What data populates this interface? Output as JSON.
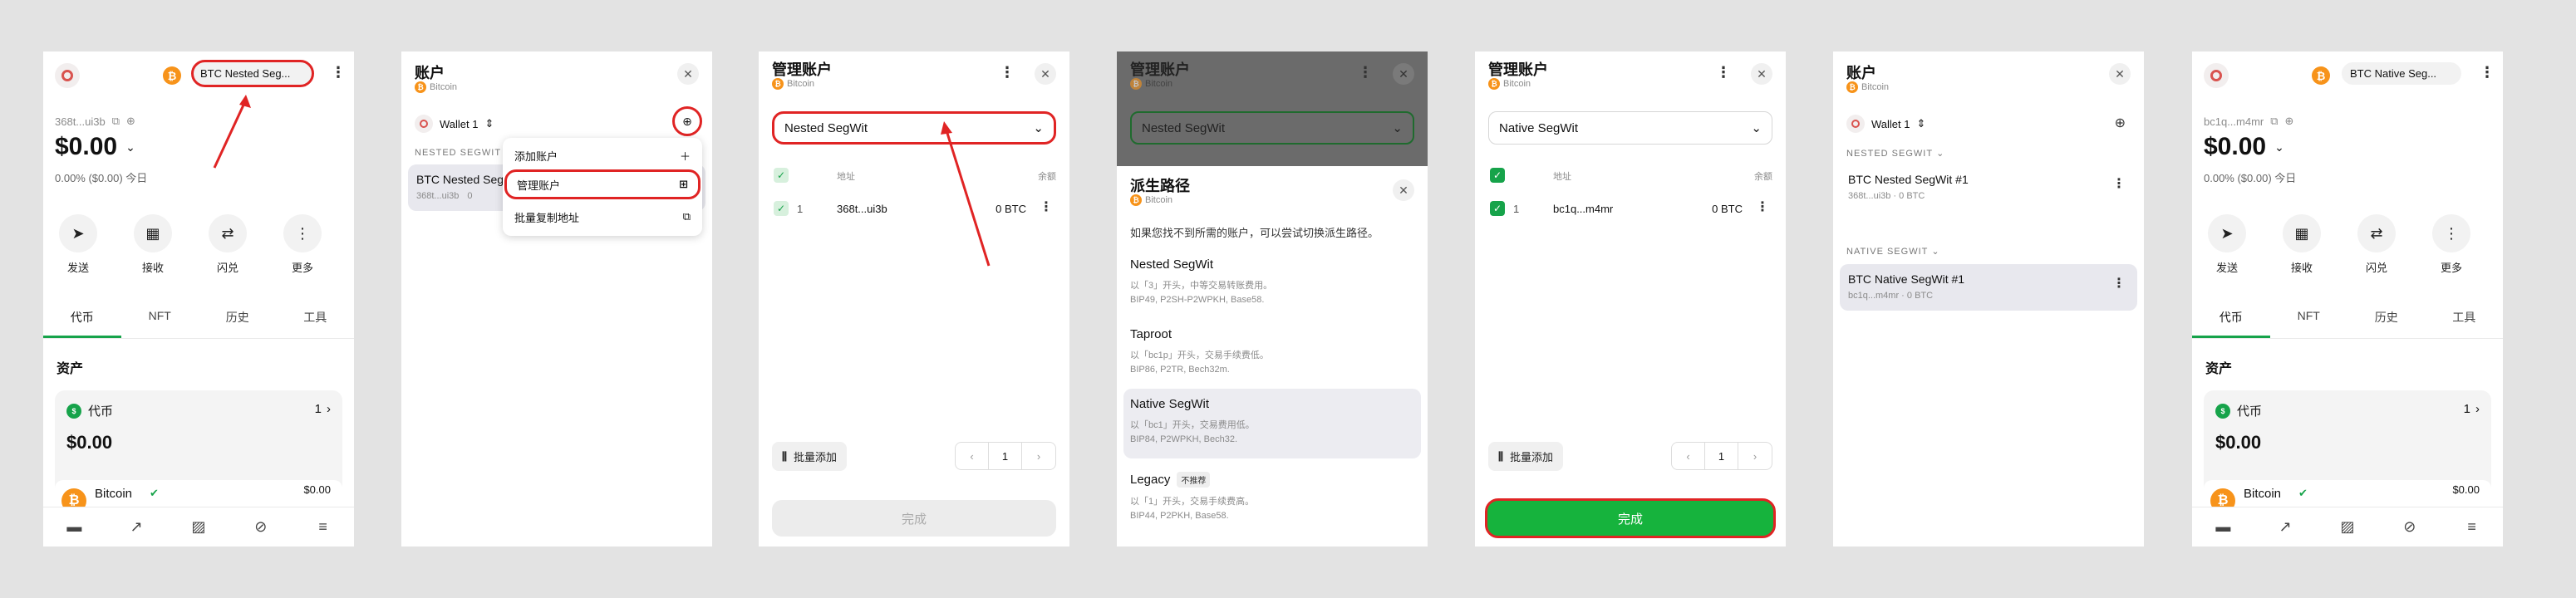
{
  "screen1": {
    "account_pill": "BTC Nested Seg...",
    "address": "368t...ui3b",
    "balance": "$0.00",
    "change": "0.00% ($0.00) 今日",
    "actions": [
      "发送",
      "接收",
      "闪兑",
      "更多"
    ],
    "tabs": [
      "代币",
      "NFT",
      "历史",
      "工具"
    ],
    "section": "资产",
    "card_title": "代币",
    "card_count": "1",
    "card_value": "$0.00",
    "token_name": "Bitcoin",
    "token_value": "$0.00"
  },
  "screen2": {
    "title": "账户",
    "subtitle": "Bitcoin",
    "wallet": "Wallet 1",
    "section": "NESTED SEGWIT",
    "account_partial": "BTC Nested Seg",
    "account_addr_partial": "368t...ui3b",
    "account_bal_partial": "0",
    "menu": [
      "添加账户",
      "管理账户",
      "批量复制地址"
    ]
  },
  "screen3": {
    "title": "管理账户",
    "subtitle": "Bitcoin",
    "select": "Nested SegWit",
    "col_address": "地址",
    "col_balance": "余额",
    "row_index": "1",
    "row_address": "368t...ui3b",
    "row_balance": "0 BTC",
    "batch": "批量添加",
    "page": "1",
    "done": "完成"
  },
  "screen4": {
    "bg_title": "管理账户",
    "bg_subtitle": "Bitcoin",
    "bg_select": "Nested SegWit",
    "title": "派生路径",
    "subtitle": "Bitcoin",
    "hint": "如果您找不到所需的账户，可以尝试切换派生路径。",
    "options": [
      {
        "name": "Nested SegWit",
        "desc1": "以「3」开头，中等交易转账费用。",
        "desc2": "BIP49, P2SH-P2WPKH, Base58."
      },
      {
        "name": "Taproot",
        "desc1": "以「bc1p」开头，交易手续费低。",
        "desc2": "BIP86, P2TR, Bech32m."
      },
      {
        "name": "Native SegWit",
        "desc1": "以「bc1」开头，交易费用低。",
        "desc2": "BIP84, P2WPKH, Bech32."
      },
      {
        "name": "Legacy",
        "desc1": "以「1」开头，交易手续费高。",
        "desc2": "BIP44, P2PKH, Base58."
      }
    ],
    "legacy_badge": "不推荐"
  },
  "screen5": {
    "title": "管理账户",
    "subtitle": "Bitcoin",
    "select": "Native SegWit",
    "col_address": "地址",
    "col_balance": "余额",
    "row_index": "1",
    "row_address": "bc1q...m4mr",
    "row_balance": "0 BTC",
    "batch": "批量添加",
    "page": "1",
    "done": "完成"
  },
  "screen6": {
    "title": "账户",
    "subtitle": "Bitcoin",
    "wallet": "Wallet 1",
    "section1": "NESTED SEGWIT",
    "acc1_name": "BTC Nested SegWit #1",
    "acc1_sub": "368t...ui3b · 0 BTC",
    "section2": "NATIVE SEGWIT",
    "acc2_name": "BTC Native SegWit #1",
    "acc2_sub": "bc1q...m4mr · 0 BTC"
  },
  "screen7": {
    "account_pill": "BTC Native Seg...",
    "address": "bc1q...m4mr",
    "balance": "$0.00",
    "change": "0.00% ($0.00) 今日",
    "actions": [
      "发送",
      "接收",
      "闪兑",
      "更多"
    ],
    "tabs": [
      "代币",
      "NFT",
      "历史",
      "工具"
    ],
    "section": "资产",
    "card_title": "代币",
    "card_count": "1",
    "card_value": "$0.00",
    "token_name": "Bitcoin",
    "token_value": "$0.00"
  },
  "colors": {
    "accent": "#16a34a",
    "highlight": "#e02424",
    "btc": "#f7931a"
  }
}
